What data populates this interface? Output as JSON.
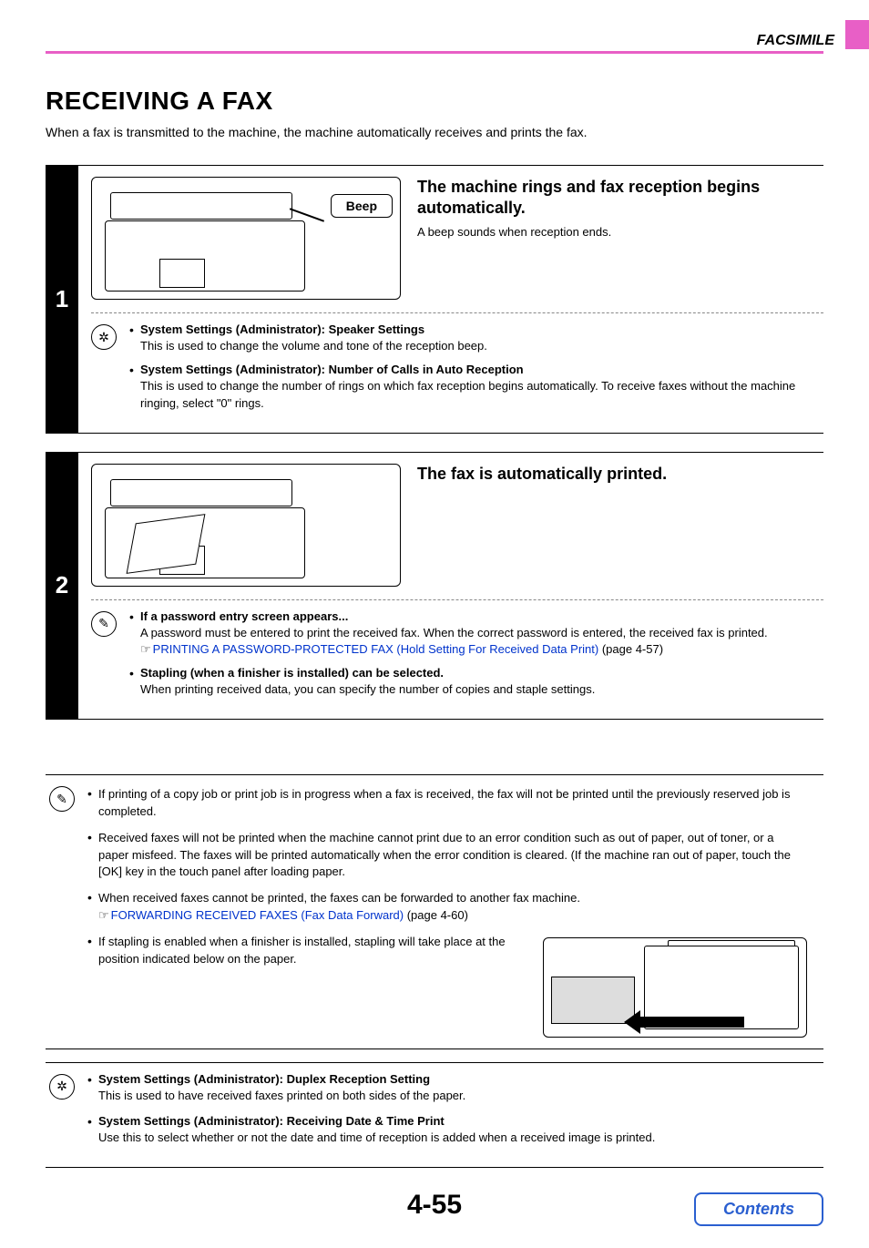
{
  "header": {
    "section": "FACSIMILE"
  },
  "title": "RECEIVING A FAX",
  "intro": "When a fax is transmitted to the machine, the machine automatically receives and prints the fax.",
  "steps": [
    {
      "num": "1",
      "beep": "Beep",
      "heading": "The machine rings and fax reception begins automatically.",
      "desc": "A beep sounds when reception ends.",
      "notes": [
        {
          "title": "System Settings (Administrator): Speaker Settings",
          "body": "This is used to change the volume and tone of the reception beep."
        },
        {
          "title": "System Settings (Administrator): Number of Calls in Auto Reception",
          "body": "This is used to change the number of rings on which fax reception begins automatically. To receive faxes without the machine ringing, select \"0\" rings."
        }
      ]
    },
    {
      "num": "2",
      "heading": "The fax is automatically printed.",
      "notes": [
        {
          "title": "If a password entry screen appears...",
          "body_pre": "A password must be entered to print the received fax. When the correct password is entered, the received fax is printed.",
          "link": "PRINTING A PASSWORD-PROTECTED FAX (Hold Setting For Received Data Print)",
          "page_ref": " (page 4-57)"
        },
        {
          "title": "Stapling (when a finisher is installed) can be selected.",
          "body": "When printing received data, you can specify the number of copies and staple settings."
        }
      ]
    }
  ],
  "lower_notes": {
    "pencil": [
      "If printing of a copy job or print job is in progress when a fax is received, the fax will not be printed until the previously reserved job is completed.",
      "Received faxes will not be printed when the machine cannot print due to an error condition such as out of paper, out of toner, or a paper misfeed. The faxes will be printed automatically when the error condition is cleared. (If the machine ran out of paper, touch the [OK] key in the touch panel after loading paper.",
      "When received faxes cannot be printed, the faxes can be forwarded to another fax machine.",
      "If stapling is enabled when a finisher is installed, stapling will take place at the position indicated below on the paper."
    ],
    "forward_link": "FORWARDING RECEIVED FAXES (Fax Data Forward)",
    "forward_page": " (page 4-60)",
    "gear": [
      {
        "title": "System Settings (Administrator): Duplex Reception Setting",
        "body": "This is used to have received faxes printed on both sides of the paper."
      },
      {
        "title": "System Settings (Administrator): Receiving Date & Time Print",
        "body": "Use this to select whether or not the date and time of reception is added when a received image is printed."
      }
    ]
  },
  "page_number": "4-55",
  "contents_label": "Contents"
}
